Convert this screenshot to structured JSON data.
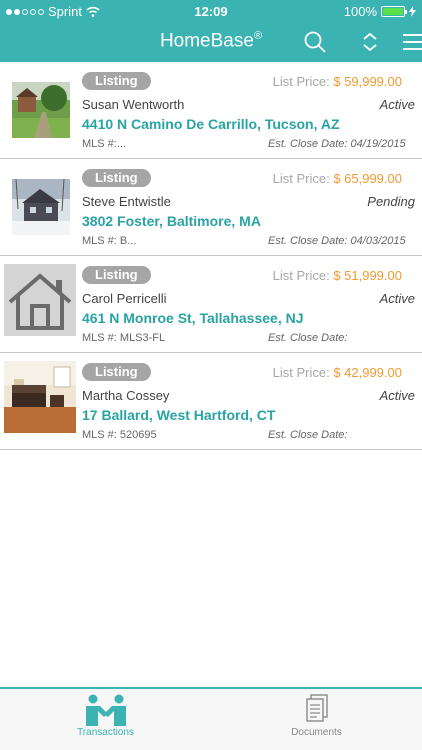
{
  "status_bar": {
    "carrier": "Sprint",
    "time": "12:09",
    "battery": "100%"
  },
  "app": {
    "title": "HomeBase",
    "title_mark": "®"
  },
  "listings": [
    {
      "badge": "Listing",
      "price_label": "List Price:",
      "price": "$ 59,999.00",
      "client": "Susan Wentworth",
      "status": "Active",
      "address": "4410 N Camino De Carrillo, Tucson, AZ",
      "mls": "MLS #:...",
      "close_label": "Est. Close Date:",
      "close_date": "04/19/2015",
      "thumb": "green-yard"
    },
    {
      "badge": "Listing",
      "price_label": "List Price:",
      "price": "$ 65,999.00",
      "client": "Steve Entwistle",
      "status": "Pending",
      "address": "3802 Foster, Baltimore, MA",
      "mls": "MLS #: B...",
      "close_label": "Est. Close Date:",
      "close_date": "04/03/2015",
      "thumb": "snow-house"
    },
    {
      "badge": "Listing",
      "price_label": "List Price:",
      "price": "$ 51,999.00",
      "client": "Carol Perricelli",
      "status": "Active",
      "address": "461 N Monroe St, Tallahassee, NJ",
      "mls": "MLS #: MLS3-FL",
      "close_label": "Est. Close Date:",
      "close_date": "",
      "thumb": "house-placeholder"
    },
    {
      "badge": "Listing",
      "price_label": "List Price:",
      "price": "$ 42,999.00",
      "client": "Martha Cossey",
      "status": "Active",
      "address": "17 Ballard, West Hartford, CT",
      "mls": "MLS #: 520695",
      "close_label": "Est. Close Date:",
      "close_date": "",
      "thumb": "living-room"
    }
  ],
  "tabs": [
    {
      "label": "Transactions",
      "icon": "handshake-icon",
      "active": true
    },
    {
      "label": "Documents",
      "icon": "documents-icon",
      "active": false
    }
  ],
  "colors": {
    "brand": "#3bb3b3",
    "price": "#f09a32",
    "address": "#2aa3a3",
    "badge": "#a5a5a5"
  }
}
